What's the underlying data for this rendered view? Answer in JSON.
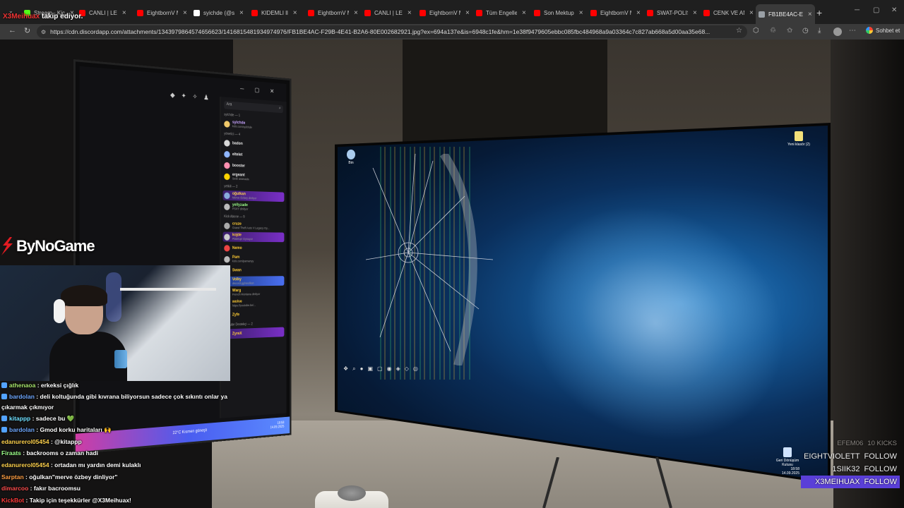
{
  "browser": {
    "tabs": [
      {
        "title": "Stream - Kic",
        "favicon_color": "#53fc18",
        "active": false
      },
      {
        "title": "CANLI | LE",
        "favicon_color": "#ff0000",
        "active": false
      },
      {
        "title": "EightbornV M",
        "favicon_color": "#ff0000",
        "active": false
      },
      {
        "title": "syichde (@sy",
        "favicon_color": "#ffffff",
        "active": false
      },
      {
        "title": "KIDEMLI ll",
        "favicon_color": "#ff0000",
        "active": false
      },
      {
        "title": "EightbornV M",
        "favicon_color": "#ff0000",
        "active": false
      },
      {
        "title": "CANLI | LE",
        "favicon_color": "#ff0000",
        "active": false
      },
      {
        "title": "EightbornV M",
        "favicon_color": "#ff0000",
        "active": false
      },
      {
        "title": "Tüm Engeller",
        "favicon_color": "#ff0000",
        "active": false
      },
      {
        "title": "Son Mektup",
        "favicon_color": "#ff0000",
        "active": false
      },
      {
        "title": "EightbornV M",
        "favicon_color": "#ff0000",
        "active": false
      },
      {
        "title": "SWAT-POLIS",
        "favicon_color": "#ff0000",
        "active": false
      },
      {
        "title": "CENK VE AM",
        "favicon_color": "#ff0000",
        "active": false
      },
      {
        "title": "FB1BE4AC-E",
        "favicon_color": "#9aa0a6",
        "active": true
      }
    ],
    "url": "https://cdn.discordapp.com/attachments/1343979864574656623/1416815481934974976/FB1BE4AC-F29B-4E41-B2A6-80E002682921.jpg?ex=694a137e&is=6948c1fe&hm=1e38f9479605ebbc085fbc484968a9a03364c7c827ab668a5d00aa35e68...",
    "chat_button": "Sohbet et"
  },
  "overlay": {
    "follow_toast_user": "X3Meihuax",
    "follow_toast_text": "takip ediyor.",
    "sponsor": "ByNoGame"
  },
  "discord": {
    "search_placeholder": "Ara",
    "sections": [
      {
        "title": "sylchde — 1",
        "members": [
          {
            "name": "sylchde",
            "sub": "kick.com/sylchde",
            "color": "#c7a3ff",
            "av": "#f0c96a"
          }
        ]
      },
      {
        "title": "yönetici — 4",
        "members": [
          {
            "name": "badon",
            "sub": "",
            "color": "#e9e9e9",
            "av": "#d9d9d9"
          },
          {
            "name": "eltelet",
            "sub": "",
            "color": "#e9e9e9",
            "av": "#8fb6ff"
          },
          {
            "name": "booster",
            "sub": "",
            "color": "#e9e9e9",
            "av": "#ff8fb0"
          },
          {
            "name": "ergeant",
            "sub": "Sesli aramada",
            "color": "#e9e9e9",
            "av": "#ffd400"
          }
        ]
      },
      {
        "title": "yetkili — 2",
        "members": [
          {
            "name": "oğulkan",
            "sub": "Merve Özbey dinliyor",
            "color": "#ffd24d",
            "av": "#8ad",
            "hl": "purple"
          },
          {
            "name": "yellyzade",
            "sub": "PSXY dinliyor",
            "color": "#9cff8a",
            "av": "#bbb"
          }
        ]
      },
      {
        "title": "Kick Abone — 9",
        "members": [
          {
            "name": "cruze",
            "sub": "Grand Theft Auto V Legacy Oy...",
            "color": "#ffcc33",
            "av": "#aaa"
          },
          {
            "name": "kojde",
            "sub": "PlateUp! Oynuyor",
            "color": "#ffcc33",
            "av": "#ccc",
            "hl": "purple"
          },
          {
            "name": "Nemo",
            "sub": "",
            "color": "#ffcc33",
            "av": "#e44"
          },
          {
            "name": "Pam",
            "sub": "kick.com/pamanyy",
            "color": "#ffcc33",
            "av": "#bbb"
          },
          {
            "name": "Swan",
            "sub": "",
            "color": "#ffcc33",
            "av": "#6af"
          },
          {
            "name": "Volky",
            "sub": "discord.gg/seolkan",
            "color": "#ffcc33",
            "av": "#ddd",
            "hl": "blue"
          },
          {
            "name": "Warg",
            "sub": "French Montana dinliyor",
            "color": "#ffcc33",
            "av": "#777"
          },
          {
            "name": "wolve",
            "sub": "https://youtube.be/...",
            "color": "#ffcc33",
            "av": "#999"
          },
          {
            "name": "Zyfe",
            "sub": "",
            "color": "#ffcc33",
            "av": "#f6f"
          }
        ]
      },
      {
        "title": "Youtube Destekçi — 2",
        "members": [
          {
            "name": "ZyreX",
            "sub": "",
            "color": "#ffcc33",
            "av": "#999",
            "hl": "purple"
          }
        ]
      }
    ],
    "weather": "22°C  Kısmen güneşli",
    "clock_time": "18:58",
    "clock_date": "14.09.2025"
  },
  "desktop": {
    "icons": [
      {
        "label": "Yeni klasör (2)",
        "color": "#f3e07a"
      },
      {
        "label": "Geri Dönüşüm Kutusu",
        "color": "#cfe3ff"
      },
      {
        "label": "Bin",
        "color": "#aaccee"
      }
    ],
    "clock_time": "18:58",
    "clock_date": "14.09.2025"
  },
  "chat": [
    {
      "user": "athenaoa",
      "user_color": "#a6e36b",
      "badge": true,
      "text": "erkeksi çığlık"
    },
    {
      "user": "bardolan",
      "user_color": "#6fa8ff",
      "badge": true,
      "text": "deli koltuğunda gibi kıvrana biliyorsun sadece çok sıkıntı onlar ya çıkarmak çıkmıyor"
    },
    {
      "user": "kitappp",
      "user_color": "#6fe0ff",
      "badge": true,
      "text": "sadece bu 💚"
    },
    {
      "user": "bardolan",
      "user_color": "#6fa8ff",
      "badge": true,
      "text": "Gmod korku haritaları 🙌"
    },
    {
      "user": "edanurerol05454",
      "user_color": "#ffd24d",
      "badge": false,
      "text": "@kitappp"
    },
    {
      "user": "Firaats",
      "user_color": "#9cff8a",
      "badge": false,
      "text": "backrooms o zaman hadi"
    },
    {
      "user": "edanurerol05454",
      "user_color": "#ffd24d",
      "badge": false,
      "text": "ortadan mı yardın demi kulaklı"
    },
    {
      "user": "Sarptan",
      "user_color": "#ff9f43",
      "badge": false,
      "text": "oğulkan\"merve özbey dinliyor\""
    },
    {
      "user": "dimarcoo",
      "user_color": "#ff4d4d",
      "badge": false,
      "text": "fakır bacroomsu"
    },
    {
      "user": "KickBot",
      "user_color": "#ff3b3b",
      "badge": false,
      "text": "Takip için teşekkürler @X3Meihuax!"
    }
  ],
  "followers": [
    {
      "name": "EFEM06",
      "action": "10 KICKS",
      "style": "dim"
    },
    {
      "name": "EIGHTVIOLETT",
      "action": "FOLLOW",
      "style": "normal"
    },
    {
      "name": "1SIIK32",
      "action": "FOLLOW",
      "style": "normal"
    },
    {
      "name": "X3MEIHUAX",
      "action": "FOLLOW",
      "style": "highlight"
    }
  ]
}
